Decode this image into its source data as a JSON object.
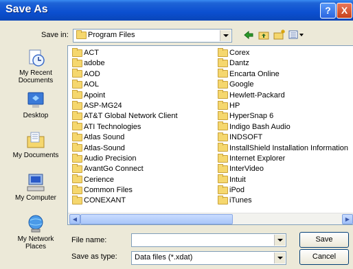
{
  "window": {
    "title": "Save As",
    "help_label": "?",
    "close_label": "X"
  },
  "toolbar": {
    "save_in_label": "Save in:",
    "save_in_value": "Program Files"
  },
  "places": [
    {
      "label": "My Recent Documents",
      "icon": "recent-documents-icon"
    },
    {
      "label": "Desktop",
      "icon": "desktop-icon"
    },
    {
      "label": "My Documents",
      "icon": "my-documents-icon"
    },
    {
      "label": "My Computer",
      "icon": "my-computer-icon"
    },
    {
      "label": "My Network Places",
      "icon": "network-places-icon"
    }
  ],
  "files_left": [
    "ACT",
    "adobe",
    "AOD",
    "AOL",
    "Apoint",
    "ASP-MG24",
    "AT&T Global Network Client",
    "ATI Technologies",
    "Atlas Sound",
    "Atlas-Sound",
    "Audio Precision",
    "AvantGo Connect",
    "Cerience",
    "Common Files",
    "CONEXANT"
  ],
  "files_right": [
    "Corex",
    "Dantz",
    "Encarta Online",
    "Google",
    "Hewlett-Packard",
    "HP",
    "HyperSnap 6",
    "Indigo Bash Audio",
    "INDSOFT",
    "InstallShield Installation Information",
    "Internet Explorer",
    "InterVideo",
    "Intuit",
    "iPod",
    "iTunes"
  ],
  "form": {
    "filename_label": "File name:",
    "filename_value": "",
    "type_label": "Save as type:",
    "type_value": "Data files (*.xdat)",
    "save_button": "Save",
    "cancel_button": "Cancel"
  }
}
